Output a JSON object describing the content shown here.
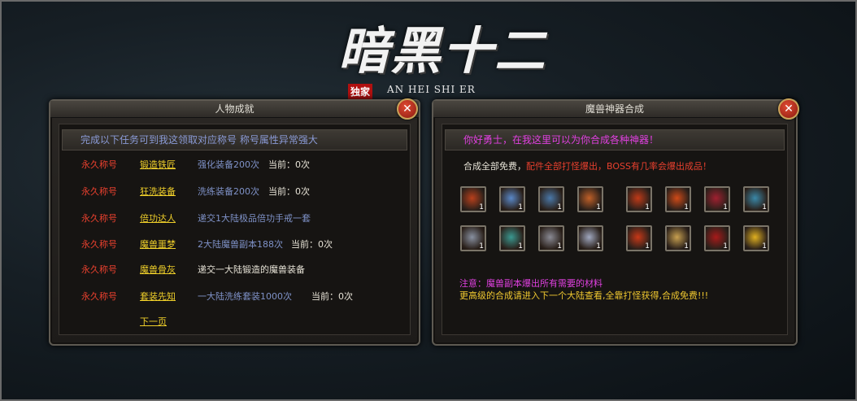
{
  "logo": {
    "title": "暗黑十二",
    "badge": "独家",
    "subtitle": "AN HEI SHI ER"
  },
  "left_panel": {
    "title": "人物成就",
    "close_label": "✕",
    "banner": "完成以下任务可到我这领取对应称号 称号属性异常强大",
    "rows": [
      {
        "tag": "永久称号",
        "name": "锻造铁匠",
        "desc": "强化装备200次",
        "current": "当前：0次"
      },
      {
        "tag": "永久称号",
        "name": "狂洗装备",
        "desc": "洗练装备200次",
        "current": "当前：0次"
      },
      {
        "tag": "永久称号",
        "name": "倍功达人",
        "desc": "递交1大陆极品倍功手戒一套",
        "current": ""
      },
      {
        "tag": "永久称号",
        "name": "魔兽噩梦",
        "desc": "2大陆魔兽副本188次",
        "current": "当前：0次"
      },
      {
        "tag": "永久称号",
        "name": "魔兽骨灰",
        "desc": "递交一大陆锻造的魔兽装备",
        "current": ""
      },
      {
        "tag": "永久称号",
        "name": "套装先知",
        "desc": "一大陆洗练套装1000次",
        "current": "当前：0次"
      }
    ],
    "next_page": "下一页"
  },
  "right_panel": {
    "title": "魔兽神器合成",
    "close_label": "✕",
    "greeting": "你好勇士，在我这里可以为你合成各种神器！",
    "free_prefix": "合成全部免费，",
    "free_suffix": "配件全部打怪爆出，BOSS有几率会爆出成品！",
    "items_group_left": [
      {
        "icon": "red-gauntlet-icon",
        "count": "1",
        "color": "#b8401c"
      },
      {
        "icon": "ice-sword-icon",
        "count": "1",
        "color": "#5a88c8"
      },
      {
        "icon": "frost-blade-icon",
        "count": "1",
        "color": "#4a78a8"
      },
      {
        "icon": "flame-gauntlet-icon",
        "count": "1",
        "color": "#c06028"
      },
      {
        "icon": "silver-armor-icon",
        "count": "1",
        "color": "#8890a0"
      },
      {
        "icon": "jade-ring-icon",
        "count": "1",
        "color": "#3a9890"
      },
      {
        "icon": "steel-blade-icon",
        "count": "1",
        "color": "#8a8a94"
      },
      {
        "icon": "holy-sword-icon",
        "count": "1",
        "color": "#a0a8c0"
      }
    ],
    "items_group_right": [
      {
        "icon": "fire-helm-icon",
        "count": "1",
        "color": "#c03a18"
      },
      {
        "icon": "lava-crest-icon",
        "count": "1",
        "color": "#d04a18"
      },
      {
        "icon": "blood-wing-icon",
        "count": "1",
        "color": "#a02030"
      },
      {
        "icon": "azure-staff-icon",
        "count": "1",
        "color": "#3a88a8"
      },
      {
        "icon": "inferno-plate-icon",
        "count": "1",
        "color": "#c83818"
      },
      {
        "icon": "amber-orb-icon",
        "count": "1",
        "color": "#c8a050"
      },
      {
        "icon": "crimson-claw-icon",
        "count": "1",
        "color": "#a81a1a"
      },
      {
        "icon": "golden-helm-icon",
        "count": "1",
        "color": "#e0b020"
      }
    ],
    "note": "注意：魔兽副本爆出所有需要的材料",
    "hint": "更高级的合成请进入下一个大陆查看,全靠打怪获得,合成免费!!!"
  }
}
